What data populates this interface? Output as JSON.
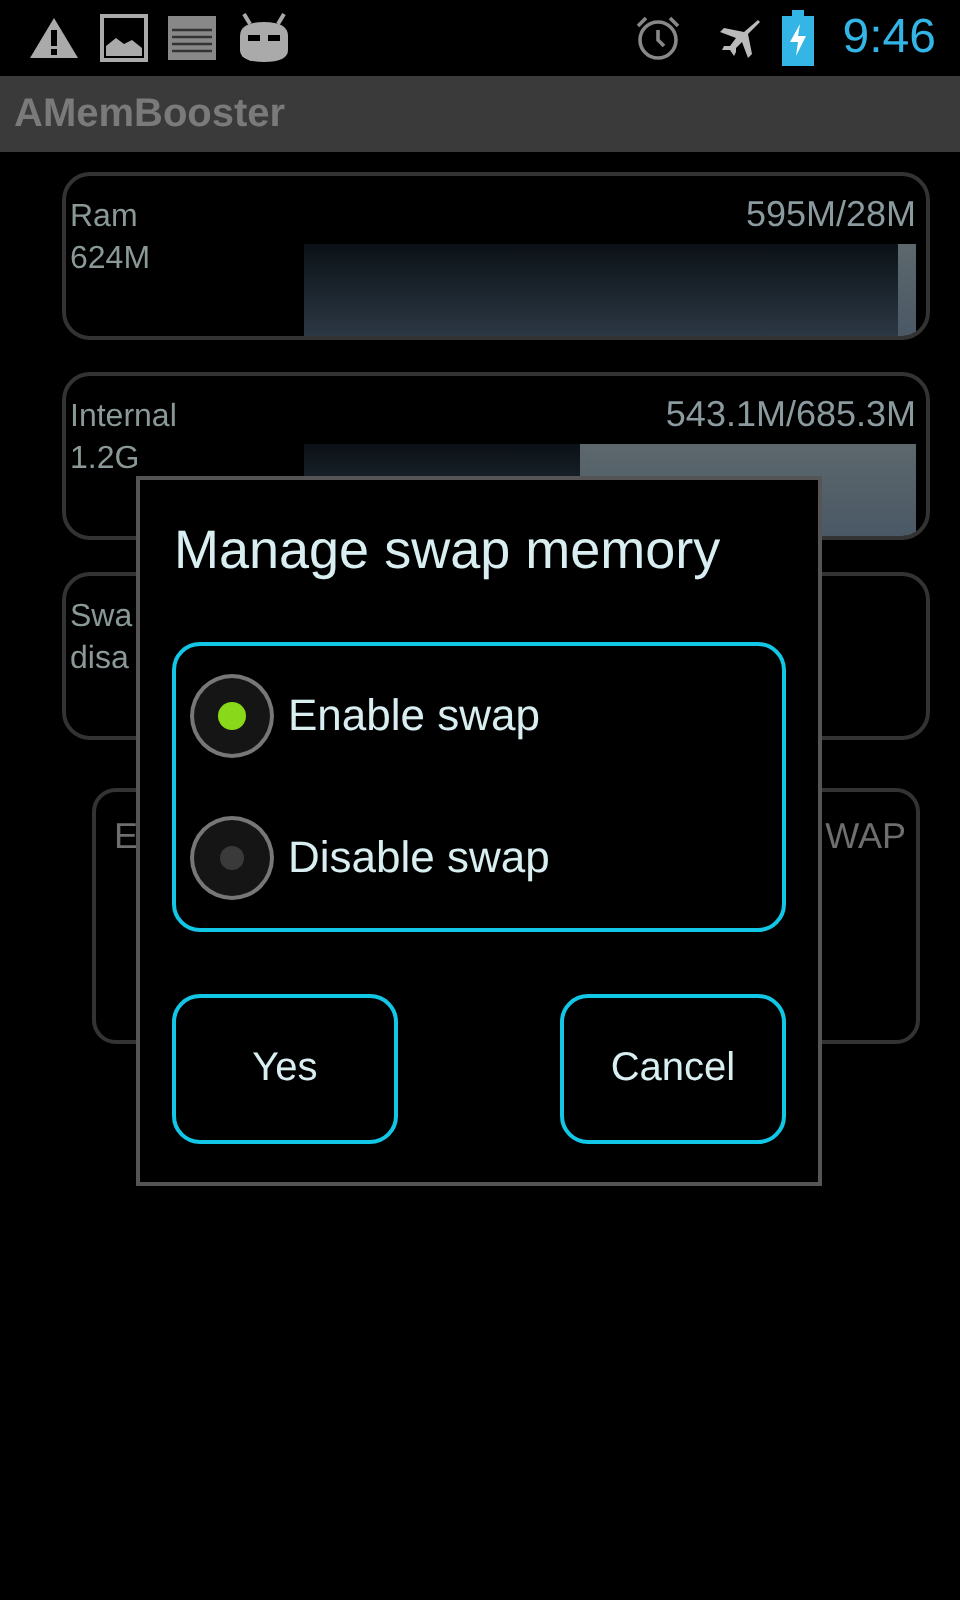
{
  "status_bar": {
    "time": "9:46"
  },
  "app_bar": {
    "title": "AMemBooster"
  },
  "memory_cards": [
    {
      "label": "Ram",
      "size": "624M",
      "usage": "595M/28M",
      "level": 0.97
    },
    {
      "label": "Internal",
      "size": "1.2G",
      "usage": "543.1M/685.3M",
      "level": 0.45
    }
  ],
  "swap_card": {
    "label": "Swa",
    "status": "disa"
  },
  "swap_button": {
    "left_text": "E",
    "right_text": "WAP"
  },
  "dialog": {
    "title": "Manage swap memory",
    "options": [
      {
        "label": "Enable swap",
        "selected": true
      },
      {
        "label": "Disable swap",
        "selected": false
      }
    ],
    "buttons": [
      "Yes",
      "Cancel"
    ]
  }
}
